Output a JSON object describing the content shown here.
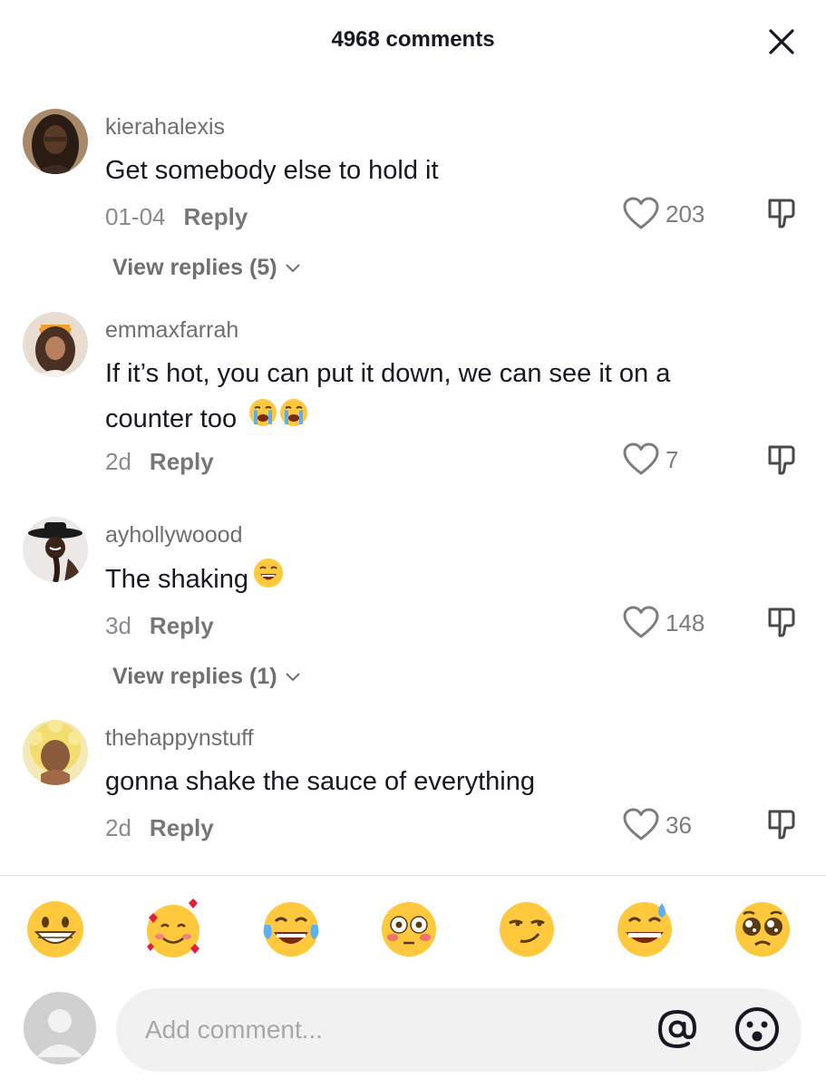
{
  "header": {
    "title": "4968 comments",
    "close_icon": "close-icon"
  },
  "comments": [
    {
      "username": "kierahalexis",
      "text": "Get somebody else to hold it",
      "date": "01-04",
      "reply_label": "Reply",
      "likes": "203",
      "view_replies": "View replies (5)"
    },
    {
      "username": "emmaxfarrah",
      "text_line1": "If it’s hot, you can put it down, we can see it on a",
      "text_line2": "counter too",
      "date": "2d",
      "reply_label": "Reply",
      "likes": "7"
    },
    {
      "username": "ayhollywoood",
      "text": "The shaking",
      "date": "3d",
      "reply_label": "Reply",
      "likes": "148",
      "view_replies": "View replies (1)"
    },
    {
      "username": "thehappynstuff",
      "text": "gonna shake the sauce of everything",
      "date": "2d",
      "reply_label": "Reply",
      "likes": "36"
    }
  ],
  "emoji_bar": [
    "grinning-face",
    "smiling-face-with-hearts",
    "face-with-tears-of-joy",
    "flushed-face",
    "smirking-face",
    "grinning-face-with-sweat",
    "pleading-face"
  ],
  "composer": {
    "placeholder": "Add comment...",
    "mention_icon": "at-icon",
    "emoji_icon": "emoji-icon"
  },
  "colors": {
    "text": "#161823",
    "muted": "#8a8b91",
    "input_bg": "#f1f1f2",
    "emoji_yellow": "#ffc83d"
  }
}
